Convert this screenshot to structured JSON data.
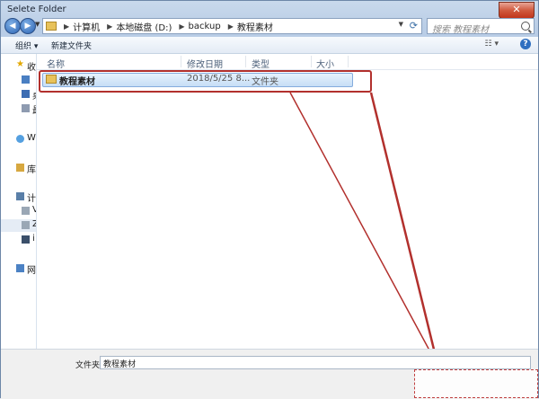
{
  "window": {
    "title": "Selete Folder",
    "close_label": "✕"
  },
  "address": {
    "crumbs": [
      "计算机",
      "本地磁盘 (D:)",
      "backup",
      "教程素材"
    ],
    "search_placeholder": "搜索 教程素材"
  },
  "toolbar": {
    "organize": "组织 ▾",
    "new_folder": "新建文件夹",
    "view": "☷ ▾",
    "help": "?"
  },
  "sidebar": {
    "items": [
      {
        "label": "收",
        "icon": "star-icon"
      },
      {
        "label": "",
        "icon": "download-icon"
      },
      {
        "label": "桌",
        "icon": "desktop-icon"
      },
      {
        "label": "最",
        "icon": "recent-icon"
      },
      {
        "label": "W",
        "icon": "cloud-icon"
      },
      {
        "label": "库",
        "icon": "library-icon"
      },
      {
        "label": "计",
        "icon": "computer-icon"
      },
      {
        "label": "V",
        "icon": "drive-icon"
      },
      {
        "label": "Z",
        "icon": "drive-icon"
      },
      {
        "label": "i",
        "icon": "drive-icon"
      },
      {
        "label": "网",
        "icon": "network-icon"
      }
    ]
  },
  "columns": {
    "name": "名称",
    "modified": "修改日期",
    "type": "类型",
    "size": "大小"
  },
  "files": [
    {
      "name": "教程素材",
      "modified": "2018/5/25 8...",
      "type": "文件夹",
      "icon": "folder-icon"
    }
  ],
  "footer": {
    "folder_label": "文件夹:",
    "folder_value": "教程素材"
  },
  "colors": {
    "highlight": "#b2302d",
    "selection": "#c6def6",
    "accent": "#2f6fc0"
  }
}
